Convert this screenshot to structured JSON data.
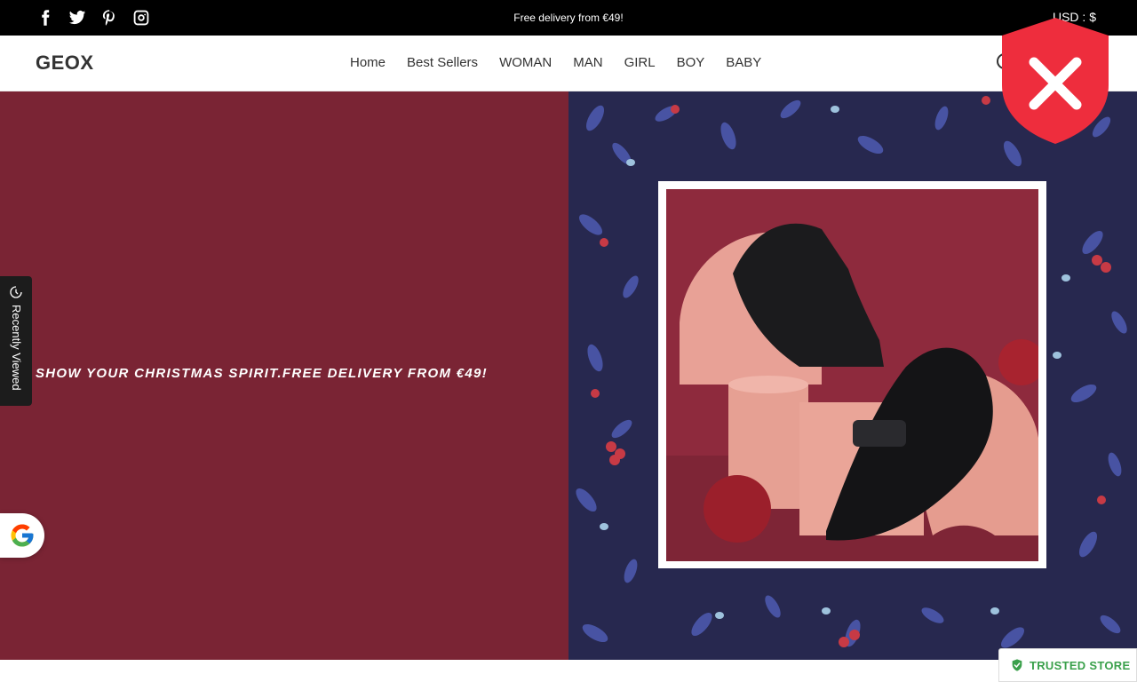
{
  "topbar": {
    "social": [
      {
        "icon": "facebook-icon"
      },
      {
        "icon": "twitter-icon"
      },
      {
        "icon": "pinterest-icon"
      },
      {
        "icon": "instagram-icon"
      }
    ],
    "announcement": "Free delivery from €49!",
    "currency": "USD : $"
  },
  "header": {
    "logo": "GEOX",
    "nav": [
      "Home",
      "Best Sellers",
      "WOMAN",
      "MAN",
      "GIRL",
      "BOY",
      "BABY"
    ]
  },
  "hero": {
    "headline": "SHOW YOUR CHRISTMAS SPIRIT.FREE DELIVERY FROM €49!",
    "left_bg": "#7a2434",
    "right_bg": "#27284f"
  },
  "recently_viewed": {
    "label": "Recently Viewed",
    "icon": "recently-viewed-icon"
  },
  "google_badge": {
    "icon": "google-icon"
  },
  "shield": {
    "icon": "shield-close-icon",
    "color": "#ee2d3d"
  },
  "trusted_store": {
    "label": "TRUSTED STORE",
    "icon": "shield-check-icon",
    "color": "#3aa04b"
  }
}
